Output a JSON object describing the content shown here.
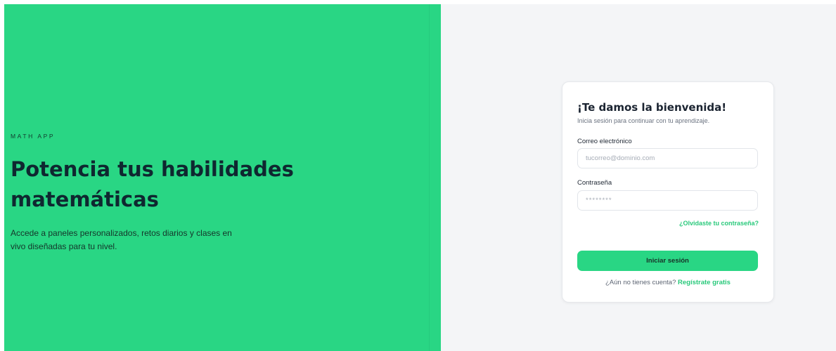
{
  "hero": {
    "brand": "MATH APP",
    "headline": "Potencia tus habilidades matemáticas",
    "description": "Accede a paneles personalizados, retos diarios y clases en vivo diseñadas para tu nivel."
  },
  "login": {
    "title": "¡Te damos la bienvenida!",
    "subtitle": "Inicia sesión para continuar con tu aprendizaje.",
    "email_label": "Correo electrónico",
    "email_placeholder": "tucorreo@dominio.com",
    "email_value": "",
    "password_label": "Contraseña",
    "password_placeholder": "********",
    "password_value": "",
    "forgot_link": "¿Olvidaste tu contraseña?",
    "submit_label": "Iniciar sesión",
    "signup_prompt": "¿Aún no tienes cuenta?",
    "signup_link": "Regístrate gratis"
  },
  "colors": {
    "accent": "#29d684",
    "link": "#29c97b",
    "panel_background": "#f4f5f7",
    "headline_text": "#0f2730"
  }
}
